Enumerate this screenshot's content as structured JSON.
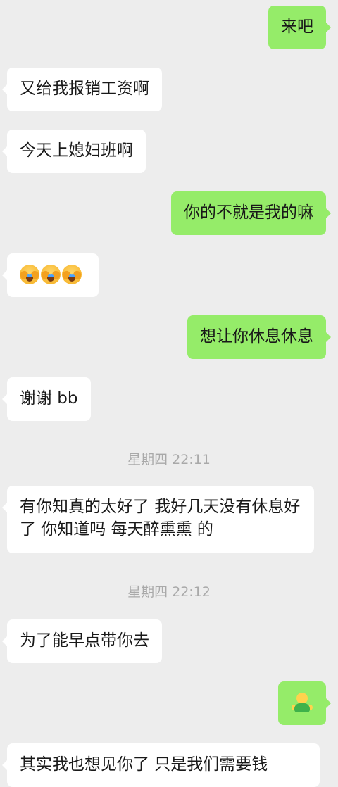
{
  "messages": [
    {
      "side": "out",
      "text": "来吧"
    },
    {
      "side": "in",
      "text": "又给我报销工资啊"
    },
    {
      "side": "in",
      "text": "今天上媳妇班啊"
    },
    {
      "side": "out",
      "text": "你的不就是我的嘛"
    },
    {
      "side": "in",
      "emoji": "face-palm-crying-emoji x3"
    },
    {
      "side": "out",
      "text": "想让你休息休息"
    },
    {
      "side": "in",
      "text": "谢谢 bb"
    },
    {
      "timestamp": "星期四 22:11"
    },
    {
      "side": "in",
      "text": "有你知真的太好了 我好几天没有休息好了 你知道吗 每天醉熏熏 的"
    },
    {
      "timestamp": "星期四 22:12"
    },
    {
      "side": "in",
      "text": "为了能早点带你去"
    },
    {
      "side": "out",
      "emoji": "person-emoji"
    },
    {
      "side": "in",
      "text": "其实我也想见你了 只是我们需要钱"
    }
  ]
}
